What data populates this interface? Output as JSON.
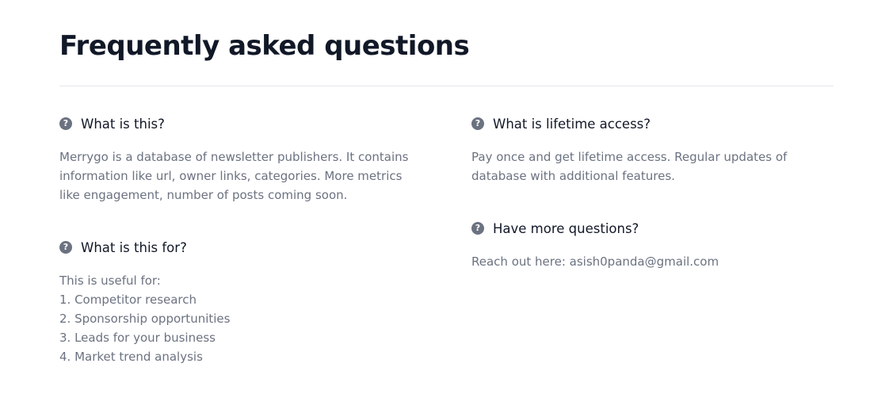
{
  "header": {
    "title": "Frequently asked questions"
  },
  "icons": {
    "question": "question-circle-icon"
  },
  "colors": {
    "heading": "#111827",
    "body_text": "#6b7280",
    "icon": "#6b7280",
    "divider": "#e5e7eb"
  },
  "faq": {
    "what_is_this": {
      "question": "What is this?",
      "answer_lines": [
        "Merrygo is a database of newsletter publishers. It contains",
        "information like url, owner links, categories. More metrics",
        "like engagement, number of posts coming soon."
      ]
    },
    "what_is_this_for": {
      "question": "What is this for?",
      "answer_lines": [
        "This is useful for:",
        "1. Competitor research",
        "2. Sponsorship opportunities",
        "3. Leads for your business",
        "4. Market trend analysis"
      ]
    },
    "lifetime_access": {
      "question": "What is lifetime access?",
      "answer_lines": [
        "Pay once and get lifetime access. Regular updates of",
        "database with additional features."
      ]
    },
    "more_questions": {
      "question": "Have more questions?",
      "answer_lines": [
        "Reach out here: asish0panda@gmail.com"
      ]
    }
  }
}
